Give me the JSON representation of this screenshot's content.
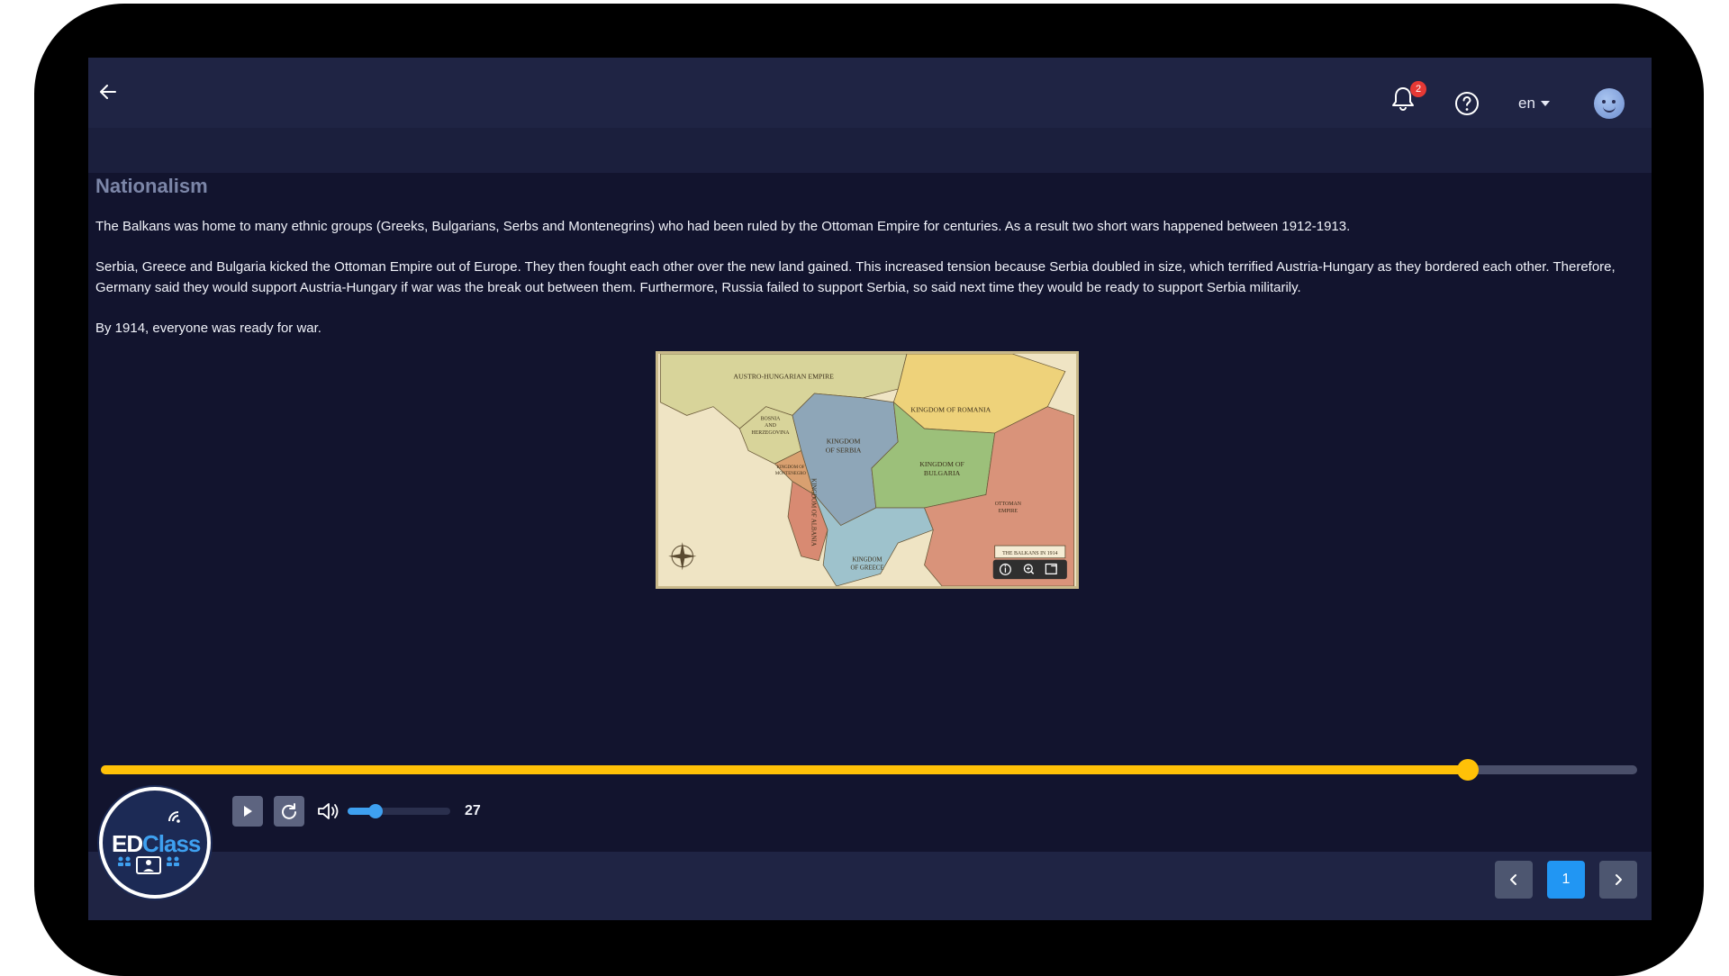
{
  "header": {
    "notifications_count": "2",
    "language": "en"
  },
  "lesson": {
    "title": "Nationalism",
    "paragraphs": [
      "The Balkans was home to many ethnic groups (Greeks, Bulgarians, Serbs and Montenegrins) who had been ruled by the Ottoman Empire for centuries. As a result two short wars happened between 1912-1913.",
      "Serbia, Greece and Bulgaria kicked the Ottoman Empire out of Europe. They then fought each other over the new land gained. This increased tension because Serbia doubled in size, which terrified Austria-Hungary as they bordered each other. Therefore, Germany said they would support Austria-Hungary if war was the break out between them. Furthermore, Russia failed to support Serbia, so said next time they would be ready to support Serbia militarily.",
      "By 1914, everyone was ready for war."
    ]
  },
  "map": {
    "labels": {
      "austro_hungarian": "AUSTRO-HUNGARIAN EMPIRE",
      "romania": "KINGDOM OF ROMANIA",
      "bosnia_1": "BOSNIA",
      "bosnia_2": "AND",
      "bosnia_3": "HERZEGOVINA",
      "serbia_1": "KINGDOM",
      "serbia_2": "OF SERBIA",
      "bulgaria_1": "KINGDOM OF",
      "bulgaria_2": "BULGARIA",
      "montenegro_1": "KINGDOM OF",
      "montenegro_2": "MONTENEGRO",
      "albania": "KINGDOM OF ALBANIA",
      "ottoman_1": "OTTOMAN",
      "ottoman_2": "EMPIRE",
      "greece_1": "KINGDOM",
      "greece_2": "OF GREECE",
      "caption": "THE BALKANS IN 1914"
    },
    "colors": {
      "austria": "#d8d49a",
      "romania": "#eed27a",
      "serbia": "#8ea6b8",
      "bulgaria": "#9cc07a",
      "albania": "#d88a72",
      "montenegro": "#d9a070",
      "greece": "#9ec2cc",
      "ottoman": "#d9937a",
      "sea": "#efe4c4"
    }
  },
  "player": {
    "progress": 0.89,
    "volume": 0.27,
    "volume_label": "27"
  },
  "pagination": {
    "current_page": "1"
  },
  "logo": {
    "part1": "ED",
    "part2": "Class"
  },
  "colors": {
    "accent": "#ffc107",
    "primary": "#2196f3",
    "background": "#12142e",
    "topbar": "#1f2444"
  }
}
